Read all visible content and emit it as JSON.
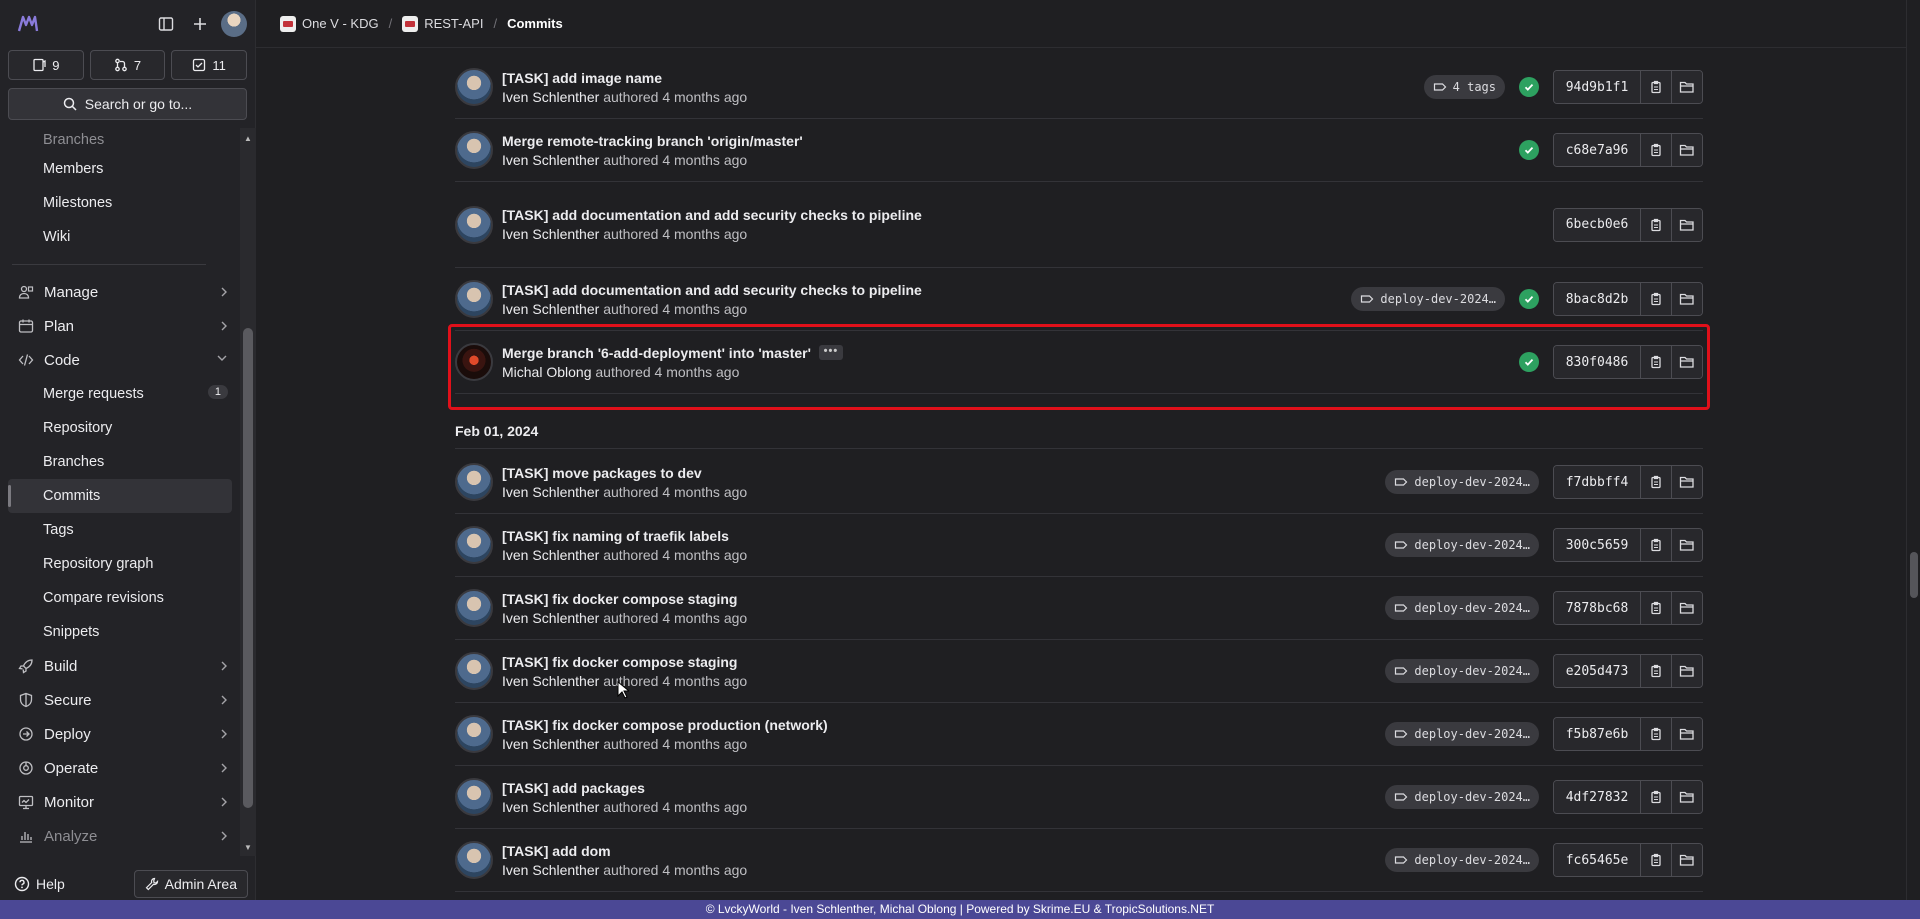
{
  "sidebar": {
    "counters": [
      {
        "icon": "issues-icon",
        "count": "9"
      },
      {
        "icon": "merge-request-icon",
        "count": "7"
      },
      {
        "icon": "todo-icon",
        "count": "11"
      }
    ],
    "search_label": "Search or go to...",
    "nav": [
      {
        "label": "Branches",
        "level": "sub",
        "dim": true
      },
      {
        "label": "Members",
        "level": "sub"
      },
      {
        "label": "Milestones",
        "level": "sub"
      },
      {
        "label": "Wiki",
        "level": "sub"
      },
      {
        "label": "Manage",
        "level": "top",
        "icon": "users-icon",
        "chevron": "right"
      },
      {
        "label": "Plan",
        "level": "top",
        "icon": "calendar-icon",
        "chevron": "right"
      },
      {
        "label": "Code",
        "level": "top",
        "icon": "code-icon",
        "chevron": "down"
      },
      {
        "label": "Merge requests",
        "level": "sub",
        "badge": "1"
      },
      {
        "label": "Repository",
        "level": "sub"
      },
      {
        "label": "Branches",
        "level": "sub"
      },
      {
        "label": "Commits",
        "level": "sub",
        "active": true
      },
      {
        "label": "Tags",
        "level": "sub"
      },
      {
        "label": "Repository graph",
        "level": "sub"
      },
      {
        "label": "Compare revisions",
        "level": "sub"
      },
      {
        "label": "Snippets",
        "level": "sub"
      },
      {
        "label": "Build",
        "level": "top",
        "icon": "rocket-icon",
        "chevron": "right"
      },
      {
        "label": "Secure",
        "level": "top",
        "icon": "shield-icon",
        "chevron": "right"
      },
      {
        "label": "Deploy",
        "level": "top",
        "icon": "deploy-icon",
        "chevron": "right"
      },
      {
        "label": "Operate",
        "level": "top",
        "icon": "operate-icon",
        "chevron": "right"
      },
      {
        "label": "Monitor",
        "level": "top",
        "icon": "monitor-icon",
        "chevron": "right"
      },
      {
        "label": "Analyze",
        "level": "top",
        "icon": "chart-icon",
        "chevron": "right",
        "dim": true
      }
    ],
    "help_label": "Help",
    "admin_label": "Admin Area"
  },
  "breadcrumb": [
    "One V - KDG",
    "REST-API",
    "Commits"
  ],
  "commits_top": [
    {
      "title": "[TASK] add image name",
      "author": "Iven Schlenther",
      "time": "authored 4 months ago",
      "tag": "4 tags",
      "status": true,
      "sha": "94d9b1f1"
    },
    {
      "title": "Merge remote-tracking branch 'origin/master'",
      "author": "Iven Schlenther",
      "time": "authored 4 months ago",
      "tag": "",
      "status": true,
      "sha": "c68e7a96"
    },
    {
      "title": "[TASK] add documentation and add security checks to pipeline",
      "author": "Iven Schlenther",
      "time": "authored 4 months ago",
      "tag": "",
      "status": false,
      "sha": "6becb0e6"
    },
    {
      "title": "[TASK] add documentation and add security checks to pipeline",
      "author": "Iven Schlenther",
      "time": "authored 4 months ago",
      "tag": "deploy-dev-2024…",
      "status": true,
      "sha": "8bac8d2b"
    },
    {
      "title": "Merge branch '6-add-deployment' into 'master'",
      "author": "Michal Oblong",
      "time": "authored 4 months ago",
      "tag": "",
      "status": true,
      "sha": "830f0486",
      "ellipsis": true,
      "dark": true
    }
  ],
  "date_header": "Feb 01, 2024",
  "commits_feb": [
    {
      "title": "[TASK] move packages to dev",
      "author": "Iven Schlenther",
      "time": "authored 4 months ago",
      "tag": "deploy-dev-2024…",
      "sha": "f7dbbff4"
    },
    {
      "title": "[TASK] fix naming of traefik labels",
      "author": "Iven Schlenther",
      "time": "authored 4 months ago",
      "tag": "deploy-dev-2024…",
      "sha": "300c5659"
    },
    {
      "title": "[TASK] fix docker compose staging",
      "author": "Iven Schlenther",
      "time": "authored 4 months ago",
      "tag": "deploy-dev-2024…",
      "sha": "7878bc68"
    },
    {
      "title": "[TASK] fix docker compose staging",
      "author": "Iven Schlenther",
      "time": "authored 4 months ago",
      "tag": "deploy-dev-2024…",
      "sha": "e205d473"
    },
    {
      "title": "[TASK] fix docker compose production (network)",
      "author": "Iven Schlenther",
      "time": "authored 4 months ago",
      "tag": "deploy-dev-2024…",
      "sha": "f5b87e6b"
    },
    {
      "title": "[TASK] add packages",
      "author": "Iven Schlenther",
      "time": "authored 4 months ago",
      "tag": "deploy-dev-2024…",
      "sha": "4df27832"
    },
    {
      "title": "[TASK] add dom",
      "author": "Iven Schlenther",
      "time": "authored 4 months ago",
      "tag": "deploy-dev-2024…",
      "sha": "fc65465e"
    }
  ],
  "footer": "© LvckyWorld - Iven Schlenther, Michal Oblong | Powered by Skrime.EU & TropicSolutions.NET",
  "colors": {
    "background": "#1f1f22",
    "sidebar": "#232327",
    "footer": "#4b4895",
    "success": "#2da160",
    "highlight": "#e0101a"
  }
}
